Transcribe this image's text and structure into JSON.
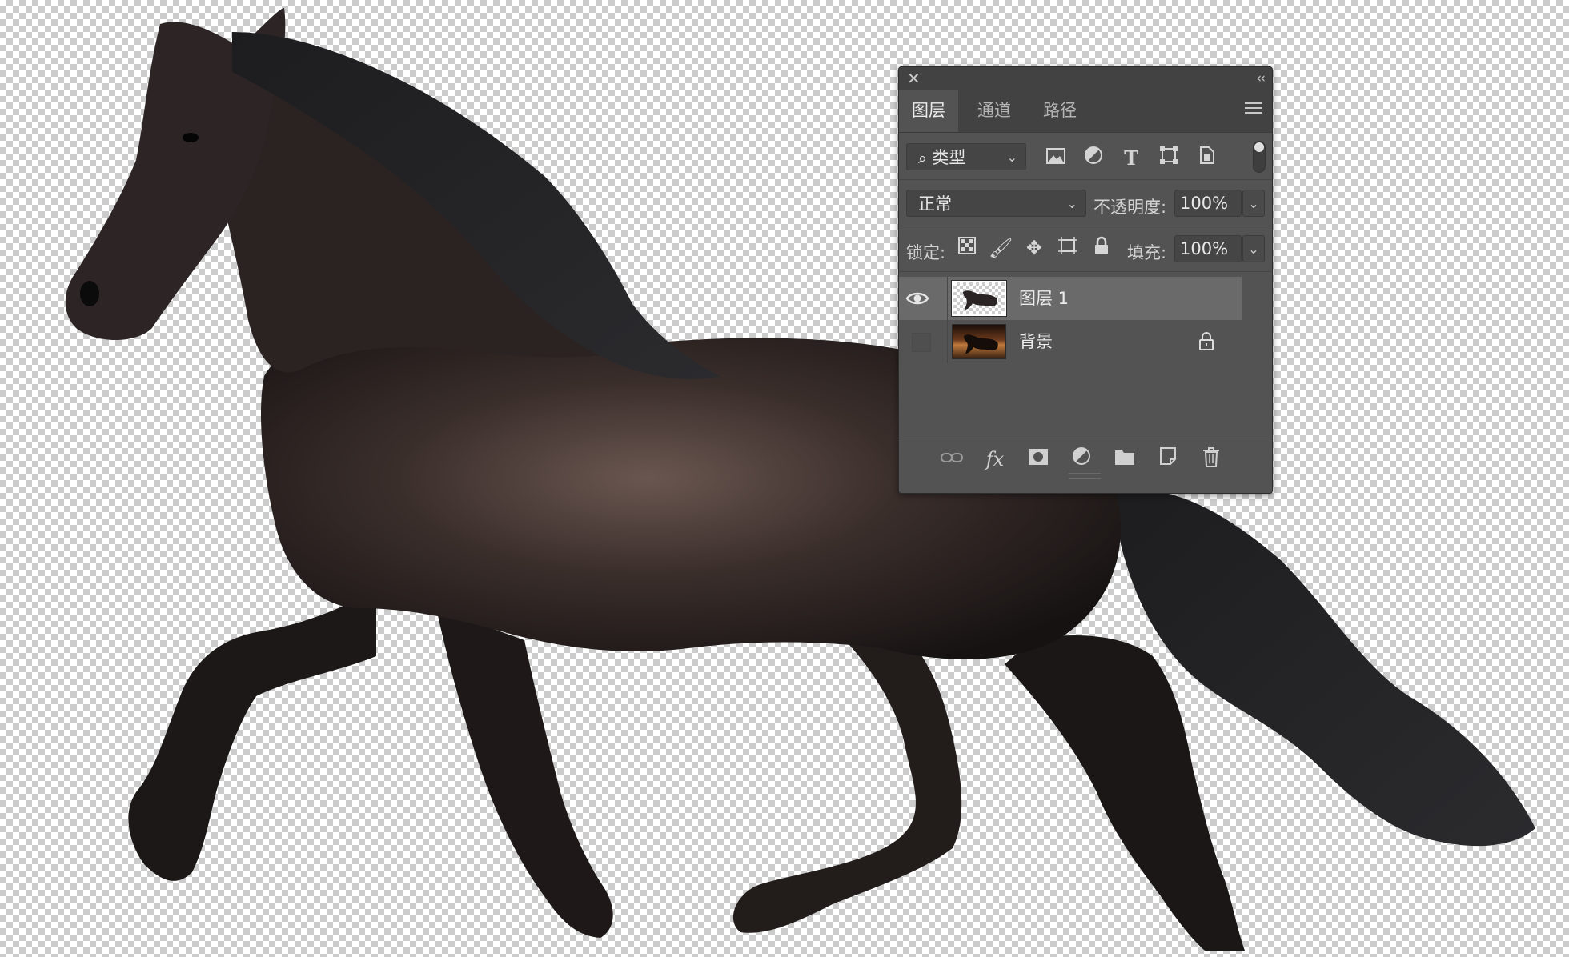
{
  "panel": {
    "tabs": [
      {
        "label": "图层",
        "active": true
      },
      {
        "label": "通道",
        "active": false
      },
      {
        "label": "路径",
        "active": false
      }
    ],
    "filter": {
      "label": "类型"
    },
    "blend_mode": "正常",
    "opacity": {
      "label": "不透明度:",
      "value": "100%"
    },
    "lock": {
      "label": "锁定:"
    },
    "fill": {
      "label": "填充:",
      "value": "100%"
    },
    "layers": [
      {
        "name": "图层 1",
        "visible": true,
        "selected": true,
        "locked": false
      },
      {
        "name": "背景",
        "visible": false,
        "selected": false,
        "locked": true
      }
    ]
  },
  "icons": {
    "close": "close-icon",
    "collapse": "collapse-icon",
    "menu": "panel-menu-icon",
    "filter_types": [
      "image-filter-icon",
      "adjustment-filter-icon",
      "type-filter-icon",
      "shape-filter-icon",
      "smart-object-filter-icon"
    ],
    "lock_types": [
      "lock-transparent-icon",
      "lock-pixels-icon",
      "lock-position-icon",
      "lock-artboard-icon",
      "lock-all-icon"
    ],
    "footer": [
      "link-layers-icon",
      "fx-icon",
      "layer-mask-icon",
      "adjustment-layer-icon",
      "new-group-icon",
      "new-layer-icon",
      "delete-layer-icon"
    ]
  },
  "colors": {
    "panel_bg": "#535353",
    "tab_bar_bg": "#424242",
    "selected_layer_bg": "#6a6a6a"
  }
}
